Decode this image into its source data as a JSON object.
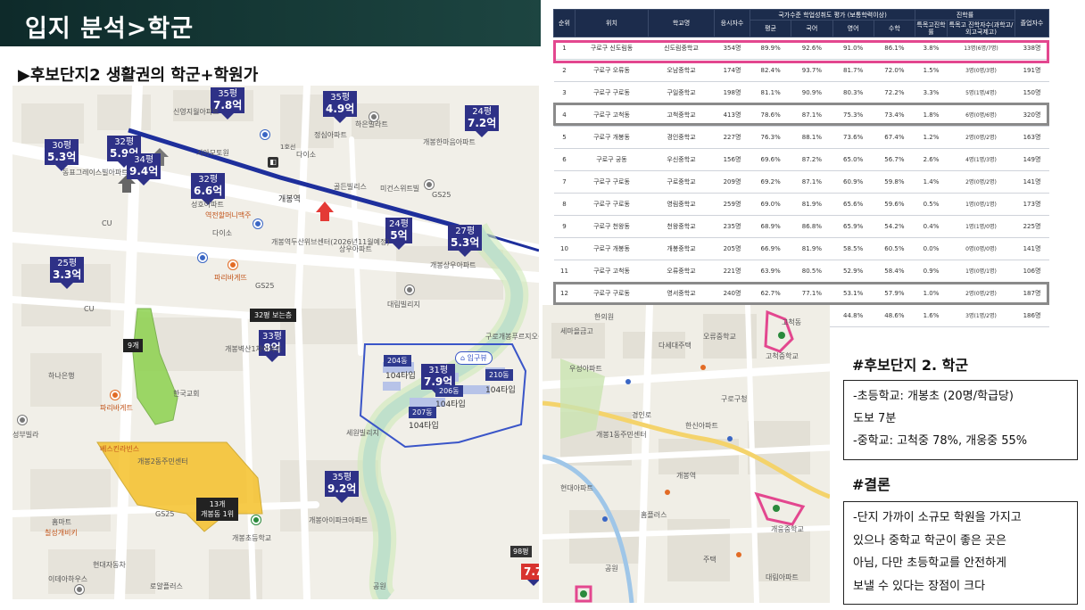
{
  "header": {
    "title": "입지 분석>학군"
  },
  "subtitle": "▶후보단지2 생활권의 학군+학원가",
  "left_map": {
    "price_tags": [
      {
        "unit": "35평",
        "value": "7.8억"
      },
      {
        "unit": "35평",
        "value": "4.9억"
      },
      {
        "unit": "24평",
        "value": "7.2억"
      },
      {
        "unit": "30평",
        "value": "5.3억"
      },
      {
        "unit": "32평",
        "value": "5.9억"
      },
      {
        "unit": "34평",
        "value": "9.4억"
      },
      {
        "unit": "32평",
        "value": "6.6억"
      },
      {
        "unit": "24평",
        "value": "5억"
      },
      {
        "unit": "27평",
        "value": "5.3억"
      },
      {
        "unit": "25평",
        "value": "3.3억"
      },
      {
        "unit": "33평",
        "value": "8억"
      },
      {
        "unit": "31평",
        "value": "7.9억"
      },
      {
        "unit": "35평",
        "value": "9.2억"
      }
    ],
    "labels": {
      "sinwol": "신영지월아파트",
      "haeun": "하은빌라트",
      "gaehwa_apt": "개봉한마음아파트",
      "jeongsim": "정심아파트",
      "giamo": "기아모토원",
      "daiso": "다이소",
      "fooltail": "동표그레이스빌아파트",
      "mr_town": "미건스위트빌",
      "golden": "골든빌리스",
      "gs25_a": "GS25",
      "gaebong_station": "개봉역",
      "station_exit": "1호선",
      "sungho": "성호아파트",
      "yeoncheon": "역전할머니맥주",
      "site_a": "개봉역두산위브센터(2026년11월예정)",
      "sangwoo": "상우아파트",
      "gaebong_sangwoo": "개봉상우아파트",
      "paris": "파리바게뜨",
      "gs25_b": "GS25",
      "daelim": "대림빌리지",
      "cu_a": "CU",
      "cu_b": "CU",
      "hana": "하나은행",
      "gaebong_1": "개봉벽산1차아파트",
      "pyeong_gyohoe": "한국교회",
      "seongbu": "성부빌라",
      "paris2": "파리바게트",
      "bestia": "베스킨라빈스",
      "gaebong2": "개봉2동주민센터",
      "gaebong_apt": "개봉아이파크아파트",
      "gaebong_elem": "개봉초등학교",
      "gs25_c": "GS25",
      "homeplus": "홈마트",
      "chilsung": "칠성개비키",
      "hyundai": "현대자동차",
      "ideal": "이데아하우스",
      "rosetown": "로얄플러스",
      "gong_won": "공원",
      "gs_sewoon": "세원빌리지",
      "gurodong": "구로개봉푸르지오생태공원",
      "daiso2": "다이소",
      "gs_bottom": "98평",
      "gs_bottom_val": "7.7"
    },
    "zone_a": {
      "count": "9개"
    },
    "zone_b": {
      "count": "13개",
      "sub": "개봉동 1위"
    },
    "apt_box": "32평 보는층",
    "dongs": [
      {
        "label": "204동"
      },
      {
        "label": "206동"
      },
      {
        "label": "207동"
      },
      {
        "label": "210동"
      }
    ],
    "types": [
      "104타입",
      "104타입",
      "104타입",
      "104타입"
    ],
    "entrance": "⌂ 입구뷰"
  },
  "table": {
    "top_header": {
      "rank": "순위",
      "location": "위치",
      "school": "학교명",
      "applicants": "응시자수",
      "eval_group": "국가수준 학업성취도 평가 (보통학력이상)",
      "advance_group": "진학률",
      "graduates": "졸업자수"
    },
    "sub_header": [
      "평균",
      "국어",
      "영어",
      "수학",
      "특목고진학률",
      "특목고 진학자수(과학고/외고국제고)"
    ],
    "rows": [
      [
        "1",
        "구로구 신도림동",
        "신도림중학교",
        "354명",
        "89.9%",
        "92.6%",
        "91.0%",
        "86.1%",
        "3.8%",
        "13명(6명/7명)",
        "338명"
      ],
      [
        "2",
        "구로구 오류동",
        "오남중학교",
        "174명",
        "82.4%",
        "93.7%",
        "81.7%",
        "72.0%",
        "1.5%",
        "3명(0명/3명)",
        "191명"
      ],
      [
        "3",
        "구로구 구로동",
        "구일중학교",
        "198명",
        "81.1%",
        "90.9%",
        "80.3%",
        "72.2%",
        "3.3%",
        "5명(1명/4명)",
        "150명"
      ],
      [
        "4",
        "구로구 고척동",
        "고척중학교",
        "413명",
        "78.6%",
        "87.1%",
        "75.3%",
        "73.4%",
        "1.8%",
        "6명(0명/6명)",
        "320명"
      ],
      [
        "5",
        "구로구 개봉동",
        "경인중학교",
        "227명",
        "76.3%",
        "88.1%",
        "73.6%",
        "67.4%",
        "1.2%",
        "2명(0명/2명)",
        "163명"
      ],
      [
        "6",
        "구로구 궁동",
        "우신중학교",
        "156명",
        "69.6%",
        "87.2%",
        "65.0%",
        "56.7%",
        "2.6%",
        "4명(1명/3명)",
        "149명"
      ],
      [
        "7",
        "구로구 구로동",
        "구로중학교",
        "209명",
        "69.2%",
        "87.1%",
        "60.9%",
        "59.8%",
        "1.4%",
        "2명(0명/2명)",
        "141명"
      ],
      [
        "8",
        "구로구 구로동",
        "영림중학교",
        "259명",
        "69.0%",
        "81.9%",
        "65.6%",
        "59.6%",
        "0.5%",
        "1명(0명/1명)",
        "173명"
      ],
      [
        "9",
        "구로구 천왕동",
        "천왕중학교",
        "235명",
        "68.9%",
        "86.8%",
        "65.9%",
        "54.2%",
        "0.4%",
        "1명(1명/0명)",
        "225명"
      ],
      [
        "10",
        "구로구 개봉동",
        "개봉중학교",
        "205명",
        "66.9%",
        "81.9%",
        "58.5%",
        "60.5%",
        "0.0%",
        "0명(0명/0명)",
        "141명"
      ],
      [
        "11",
        "구로구 고척동",
        "오류중학교",
        "221명",
        "63.9%",
        "80.5%",
        "52.9%",
        "58.4%",
        "0.9%",
        "1명(0명/1명)",
        "106명"
      ],
      [
        "12",
        "구로구 구로동",
        "영서중학교",
        "240명",
        "62.7%",
        "77.1%",
        "53.1%",
        "57.9%",
        "1.0%",
        "2명(0명/2명)",
        "187명"
      ],
      [
        "13",
        "구로구 개봉동",
        "개웅중학교",
        "278명",
        "55.4%",
        "72.9%",
        "44.8%",
        "48.6%",
        "1.6%",
        "3명(1명/2명)",
        "186명"
      ]
    ]
  },
  "right_map": {
    "labels": [
      "한의원",
      "세마을금고",
      "고척동",
      "다세대주택",
      "오류중학교",
      "우성아파트",
      "구로구청",
      "고척중학교",
      "개봉역",
      "개웅중학교",
      "개봉1동주민센터",
      "경인로",
      "한신아파트",
      "현대아파트",
      "홈플러스",
      "주택",
      "공원",
      "대림아파트"
    ]
  },
  "school_section": {
    "heading": "#후보단지 2. 학군",
    "lines": [
      "-초등학교: 개봉초 (20명/학급당)",
      "도보 7분",
      "-중학교: 고척중 78%, 개웅중 55%"
    ]
  },
  "conclusion_section": {
    "heading": "#결론",
    "lines": [
      "-단지 가까이 소규모 학원을 가지고",
      "있으나 중학교 학군이 좋은 곳은",
      "아님, 다만 초등학교를 안전하게",
      "보낼 수 있다는 장점이 크다"
    ]
  },
  "colors": {
    "banner": "#163a37",
    "price_tag": "#2e3187",
    "highlight_pink": "#e3478f",
    "highlight_gray": "#8a8a8a",
    "zone_green": "#8dd24f",
    "zone_yellow": "#f5c12a",
    "subway_line": "#1e2f9c",
    "table_header": "#1c2c4c"
  }
}
